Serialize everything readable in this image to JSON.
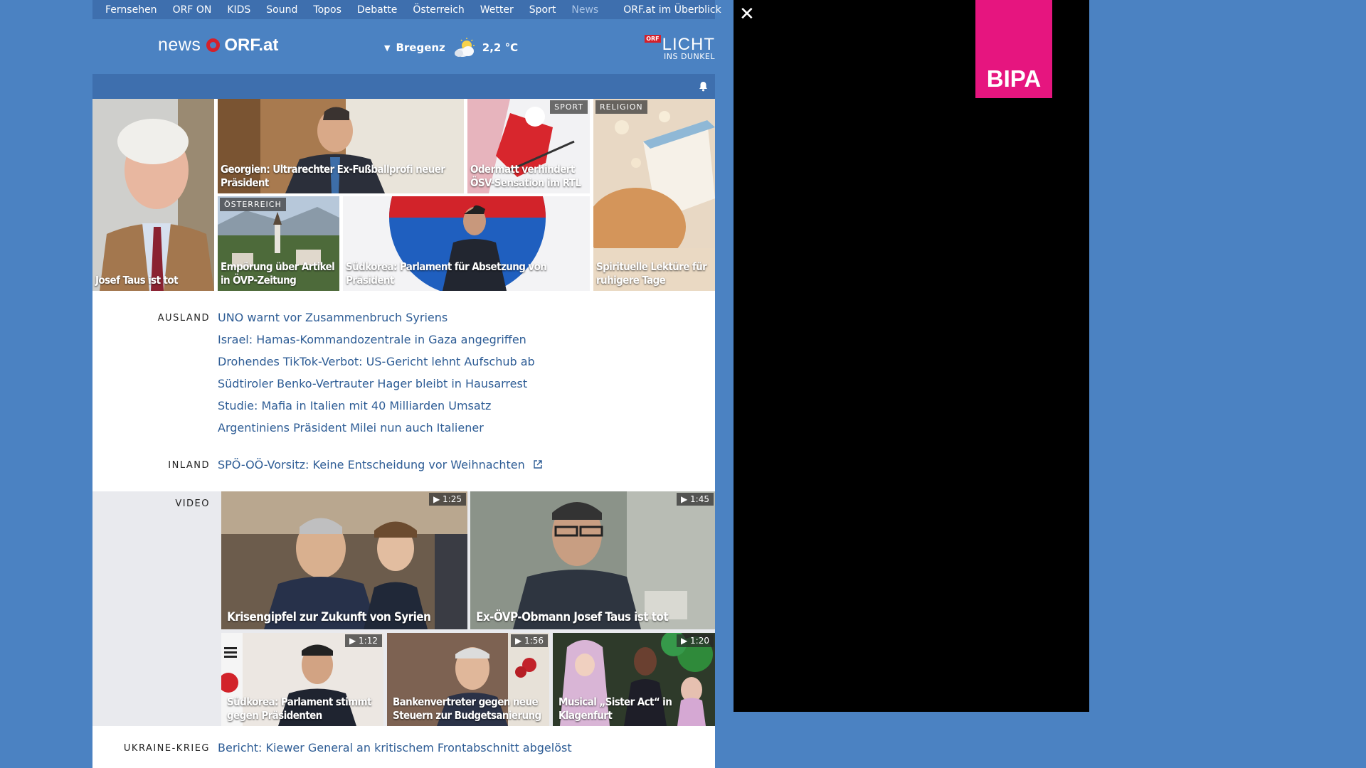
{
  "nav": {
    "items": [
      "Fernsehen",
      "ORF ON",
      "KIDS",
      "Sound",
      "Topos",
      "Debatte",
      "Österreich",
      "Wetter",
      "Sport",
      "News"
    ],
    "overview": "ORF.at im Überblick"
  },
  "header": {
    "logo_news": "news",
    "logo_orf": "ORF.at",
    "weather_city": "Bregenz",
    "weather_temp": "2,2 °C",
    "licht_orf": "ORF",
    "licht_big": "LICHT",
    "licht_small": "INS DUNKEL"
  },
  "tiles": {
    "taus": "Josef Taus ist tot",
    "georgien": "Georgien: Ultrarechter Ex-Fußballprofi neuer Präsident",
    "odermatt_tag": "SPORT",
    "odermatt": "Odermatt verhindert ÖSV-Sensation im RTL",
    "religion_tag": "RELIGION",
    "religion": "Spirituelle Lektüre für ruhigere Tage",
    "oesterreich_tag": "ÖSTERREICH",
    "empoerung": "Empörung über Artikel in ÖVP-Zeitung",
    "suedkorea": "Südkorea: Parlament für Absetzung von Präsident"
  },
  "ausland": {
    "label": "AUSLAND",
    "links": [
      "UNO warnt vor Zusammenbruch Syriens",
      "Israel: Hamas-Kommandozentrale in Gaza angegriffen",
      "Drohendes TikTok-Verbot: US-Gericht lehnt Aufschub ab",
      "Südtiroler Benko-Vertrauter Hager bleibt in Hausarrest",
      "Studie: Mafia in Italien mit 40 Milliarden Umsatz",
      "Argentiniens Präsident Milei nun auch Italiener"
    ]
  },
  "inland": {
    "label": "INLAND",
    "link": "SPÖ-OÖ-Vorsitz: Keine Entscheidung vor Weihnachten"
  },
  "video": {
    "label": "VIDEO",
    "items": [
      {
        "title": "Krisengipfel zur Zukunft von Syrien",
        "duration": "1:25"
      },
      {
        "title": "Ex-ÖVP-Obmann Josef Taus ist tot",
        "duration": "1:45"
      },
      {
        "title": "Südkorea: Parlament stimmt gegen Präsidenten",
        "duration": "1:12"
      },
      {
        "title": "Bankenvertreter gegen neue Steuern zur Budgetsanierung",
        "duration": "1:56"
      },
      {
        "title": "Musical „Sister Act“ in Klagenfurt",
        "duration": "1:20"
      }
    ]
  },
  "ukraine": {
    "label": "UKRAINE-KRIEG",
    "link": "Bericht: Kiewer General an kritischem Frontabschnitt abgelöst"
  },
  "ad": {
    "close": "✕",
    "brand": "BIPA"
  }
}
